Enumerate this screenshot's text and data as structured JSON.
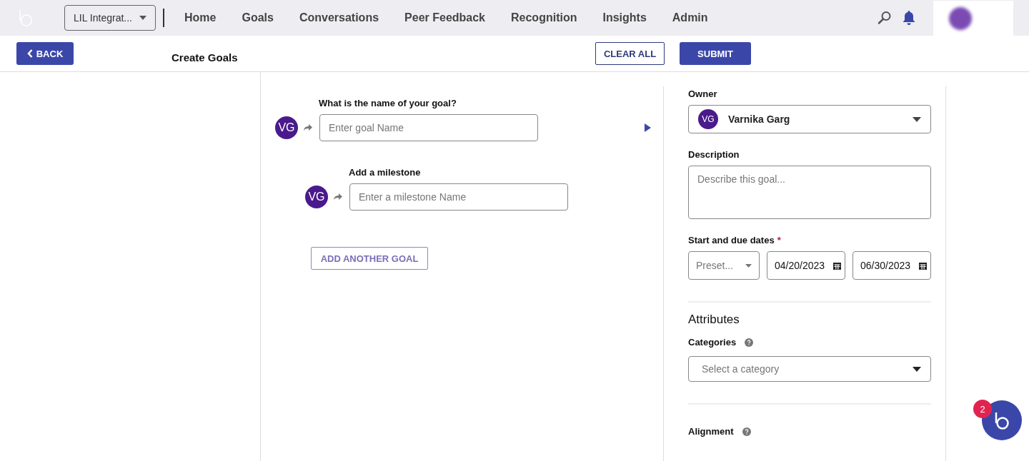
{
  "nav": {
    "org_selector": "LIL Integrat...",
    "links": [
      {
        "label": "Home"
      },
      {
        "label": "Goals"
      },
      {
        "label": "Conversations"
      },
      {
        "label": "Peer Feedback"
      },
      {
        "label": "Recognition"
      },
      {
        "label": "Insights"
      },
      {
        "label": "Admin"
      }
    ]
  },
  "toolbar": {
    "back": "BACK",
    "title": "Create Goals",
    "clear": "CLEAR ALL",
    "submit": "SUBMIT"
  },
  "goal": {
    "label": "What is the name of your goal?",
    "avatar": "VG",
    "placeholder": "Enter goal Name"
  },
  "milestone": {
    "label": "Add a milestone",
    "avatar": "VG",
    "placeholder": "Enter a milestone Name"
  },
  "add_button": "ADD ANOTHER GOAL",
  "details": {
    "owner": {
      "label": "Owner",
      "avatar": "VG",
      "name": "Varnika Garg"
    },
    "description": {
      "label": "Description",
      "placeholder": "Describe this goal..."
    },
    "dates": {
      "label": "Start and due dates",
      "required": true,
      "required_mark": "*",
      "preset_placeholder": "Preset...",
      "start": "04/20/2023",
      "due": "06/30/2023"
    },
    "attributes": {
      "heading": "Attributes",
      "categories": {
        "label": "Categories",
        "placeholder": "Select a category"
      },
      "alignment": {
        "label": "Alignment"
      }
    }
  },
  "chat": {
    "badge": "2"
  }
}
